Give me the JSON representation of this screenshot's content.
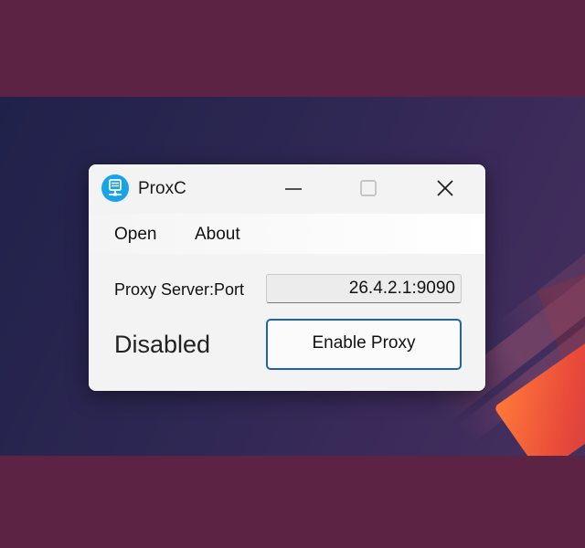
{
  "window": {
    "title": "ProxC",
    "icon": "network-server-icon",
    "accent_color": "#1aa3e8"
  },
  "controls": {
    "minimize": "minimize-icon",
    "maximize": "maximize-icon",
    "close": "close-icon"
  },
  "menu": {
    "items": [
      {
        "label": "Open"
      },
      {
        "label": "About"
      }
    ]
  },
  "proxy": {
    "label": "Proxy Server:Port",
    "value": "26.4.2.1:9090"
  },
  "status": {
    "text": "Disabled"
  },
  "actions": {
    "enable_label": "Enable Proxy",
    "button_border_color": "#1a63b8"
  }
}
